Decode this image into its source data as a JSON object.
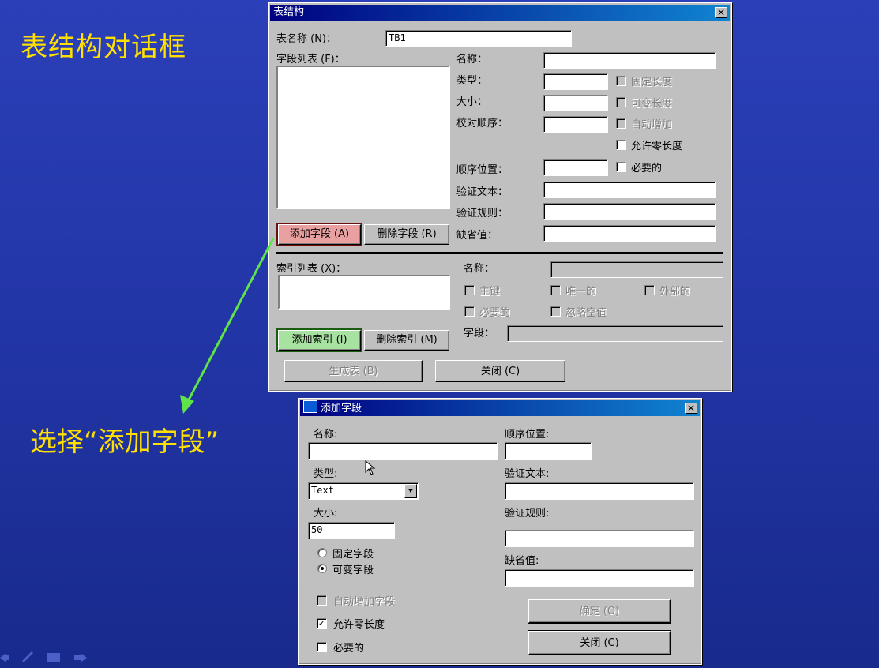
{
  "slide": {
    "title": "表结构对话框",
    "caption": "选择“添加字段”"
  },
  "table_dialog": {
    "title": "表结构",
    "close_glyph": "✕",
    "table_name_label": "表名称 (N)：",
    "table_name_value": "TB1",
    "field_list_label": "字段列表 (F)：",
    "name_label": "名称：",
    "type_label": "类型：",
    "size_label": "大小：",
    "collation_label": "校对顺序：",
    "fixed_length": "固定长度",
    "variable_length": "可变长度",
    "auto_increment": "自动增加",
    "allow_zero_length": "允许零长度",
    "ordinal_label": "顺序位置：",
    "required": "必要的",
    "validation_text_label": "验证文本：",
    "validation_rule_label": "验证规则：",
    "default_value_label": "缺省值：",
    "add_field_button": "添加字段 (A)",
    "delete_field_button": "删除字段 (R)",
    "index_list_label": "索引列表 (X)：",
    "index_name_label": "名称：",
    "primary": "主键",
    "unique": "唯一的",
    "foreign": "外部的",
    "index_required": "必要的",
    "ignore_nulls": "忽略空值",
    "index_fields_label": "字段：",
    "add_index_button": "添加索引 (I)",
    "delete_index_button": "删除索引 (M)",
    "build_table_button": "生成表 (B)",
    "close_button": "关闭 (C)"
  },
  "add_field_dialog": {
    "title": "添加字段",
    "close_glyph": "✕",
    "name_label": "名称:",
    "name_value": "",
    "ordinal_label": "顺序位置:",
    "ordinal_value": "",
    "type_label": "类型:",
    "type_value": "Text",
    "validation_text_label": "验证文本:",
    "validation_text_value": "",
    "size_label": "大小:",
    "size_value": "50",
    "validation_rule_label": "验证规则:",
    "validation_rule_value": "",
    "fixed_field": "固定字段",
    "variable_field": "可变字段",
    "default_value_label": "缺省值:",
    "default_value_value": "",
    "auto_increment_field": "自动增加字段",
    "allow_zero_length": "允许零长度",
    "required": "必要的",
    "ok_button": "确定 (O)",
    "close_button": "关闭 (C)",
    "combo_arrow": "▼",
    "check_mark": "✓"
  },
  "annotation": {
    "arrow_color": "#5fe34a"
  }
}
